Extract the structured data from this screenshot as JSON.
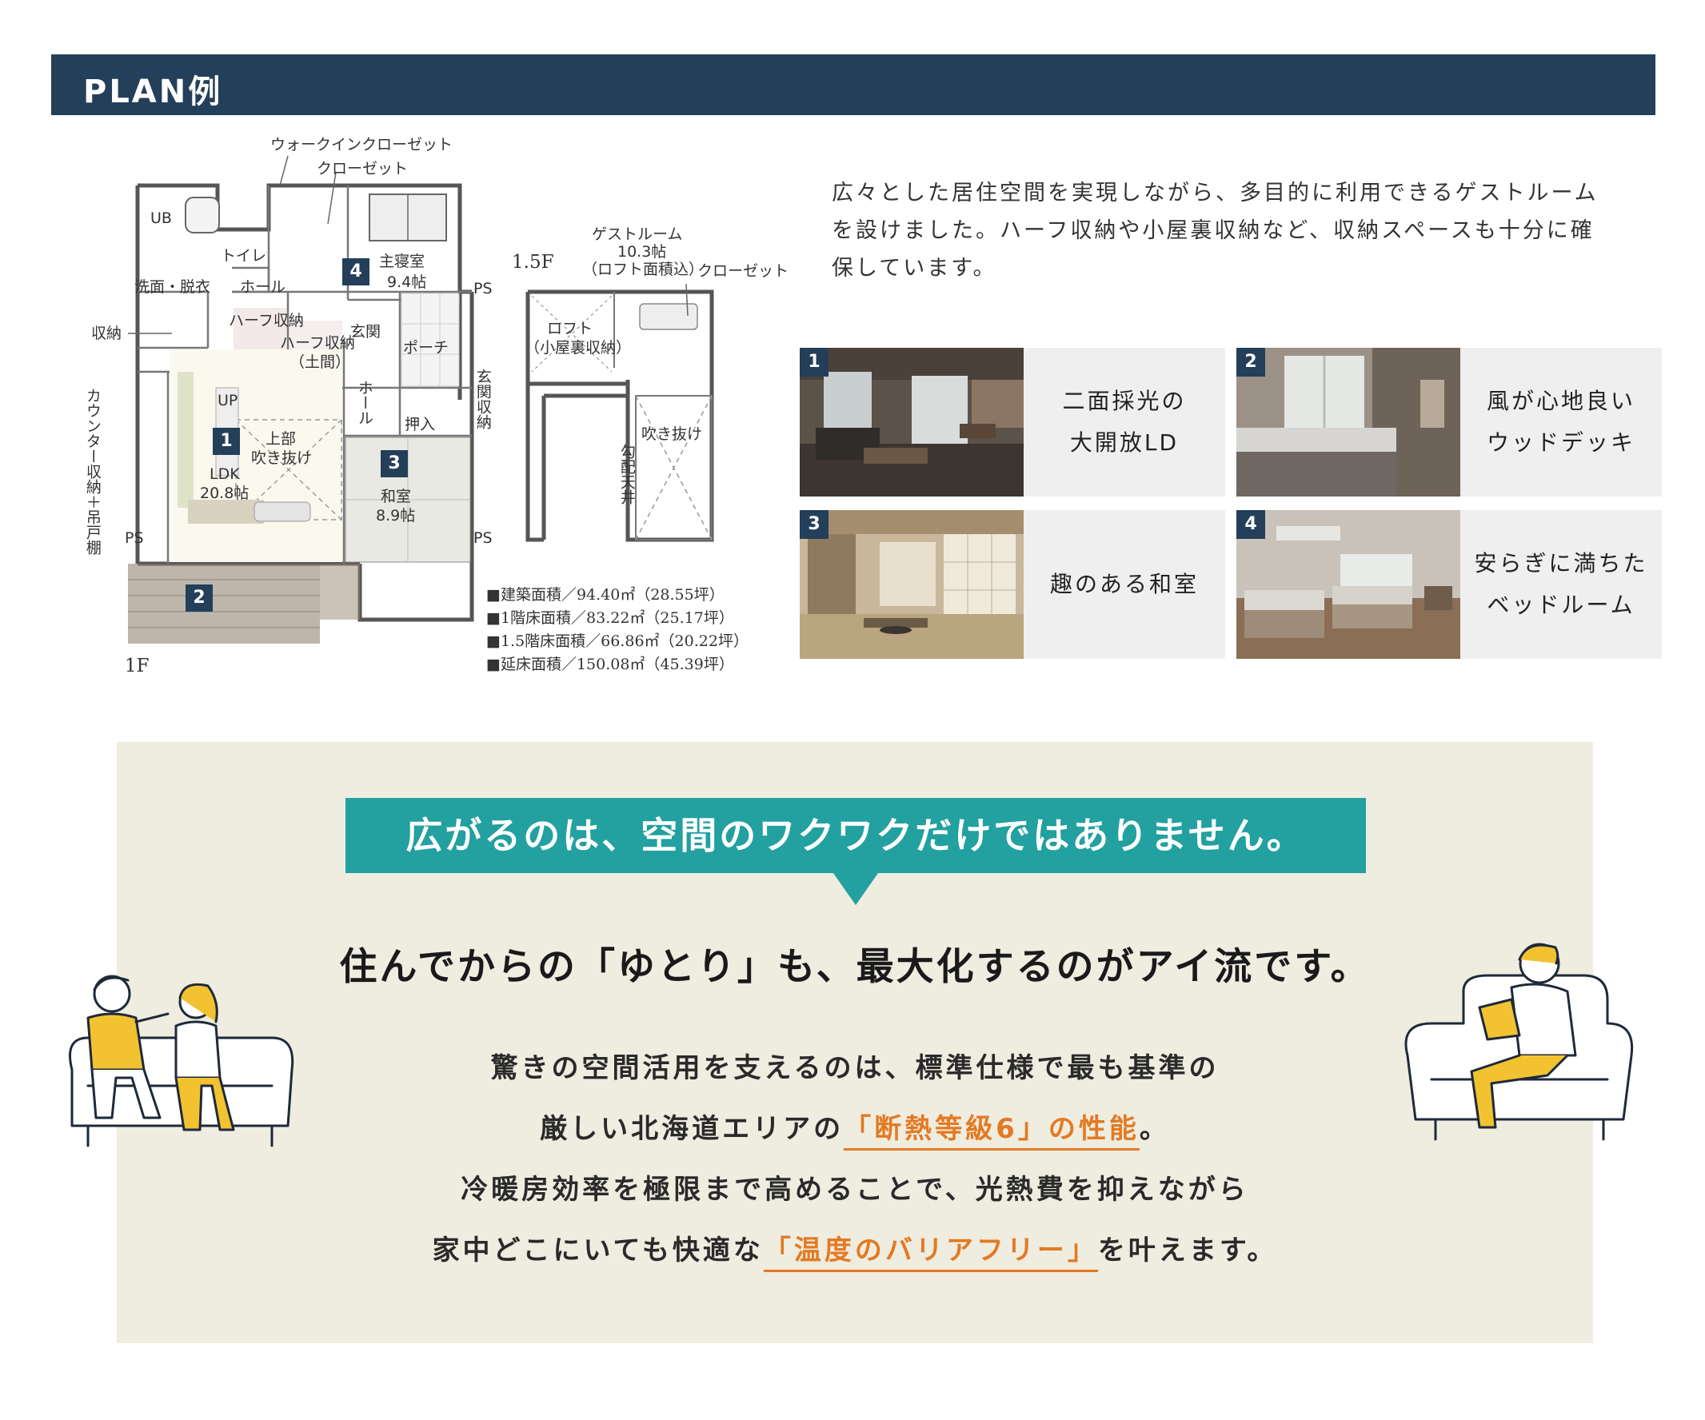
{
  "header": {
    "title": "PLAN例"
  },
  "floorplan": {
    "labels": {
      "walkin_closet": "ウォークインクローゼット",
      "closet_top": "クローゼット",
      "ub": "UB",
      "toilet": "トイレ",
      "washroom": "洗面・脱衣",
      "hall_top": "ホール",
      "master_bedroom": "主寝室",
      "master_bedroom_size": "9.4帖",
      "ps1": "PS",
      "storage": "収納",
      "half_storage": "ハーフ収納",
      "half_storage_doma": "ハーフ収納",
      "doma": "（土間）",
      "entrance": "玄関",
      "porch": "ポーチ",
      "hall_mid": "ホール",
      "up": "UP",
      "void_upper": "上部",
      "void_upper2": "吹き抜け",
      "ldk": "LDK",
      "ldk_size": "20.8帖",
      "oshiire": "押入",
      "japanese_room": "和室",
      "japanese_room_size": "8.9帖",
      "entrance_storage": "玄関収納",
      "counter_storage": "カウンター収納＋吊戸棚",
      "ps2": "PS",
      "ps3": "PS",
      "floor_1f": "1F",
      "floor_15f": "1.5F",
      "guest_room": "ゲストルーム",
      "guest_room_size": "10.3帖",
      "guest_room_note": "（ロフト面積込）",
      "closet_15": "クローゼット",
      "loft": "ロフト",
      "loft_note": "（小屋裏収納）",
      "void_15": "吹き抜け",
      "slope_ceiling": "勾配天井",
      "badge1": "1",
      "badge2": "2",
      "badge3": "3",
      "badge4": "4"
    },
    "stats": [
      "■建築面積／94.40㎡（28.55坪）",
      "■1階床面積／83.22㎡（25.17坪）",
      "■1.5階床面積／66.86㎡（20.22坪）",
      "■延床面積／150.08㎡（45.39坪）"
    ]
  },
  "intro": "広々とした居住空間を実現しながら、多目的に利用できるゲストルームを設けました。ハーフ収納や小屋裏収納など、収納スペースも十分に確保しています。",
  "cards": [
    {
      "num": "1",
      "caption": "二面採光の\n大開放LD"
    },
    {
      "num": "2",
      "caption": "風が心地良い\nウッドデッキ"
    },
    {
      "num": "3",
      "caption": "趣のある和室"
    },
    {
      "num": "4",
      "caption": "安らぎに満ちた\nベッドルーム"
    }
  ],
  "feature": {
    "banner": "広がるのは、空間のワクワクだけではありません。",
    "headline": "住んでからの「ゆとり」も、最大化するのがアイ流です。",
    "line1": "驚きの空間活用を支えるのは、標準仕様で最も基準の",
    "line2_pre": "厳しい北海道エリアの",
    "line2_hl": "「断熱等級6」の性能",
    "line2_post": "。",
    "line3": "冷暖房効率を極限まで高めることで、光熱費を抑えながら",
    "line4_pre": "家中どこにいても快適な",
    "line4_hl": "「温度のバリアフリー」",
    "line4_post": "を叶えます。"
  },
  "colors": {
    "navy": "#233f5a",
    "teal": "#23a0a0",
    "orange": "#e37a22",
    "beige": "#efece0",
    "yellow": "#f2c230"
  }
}
